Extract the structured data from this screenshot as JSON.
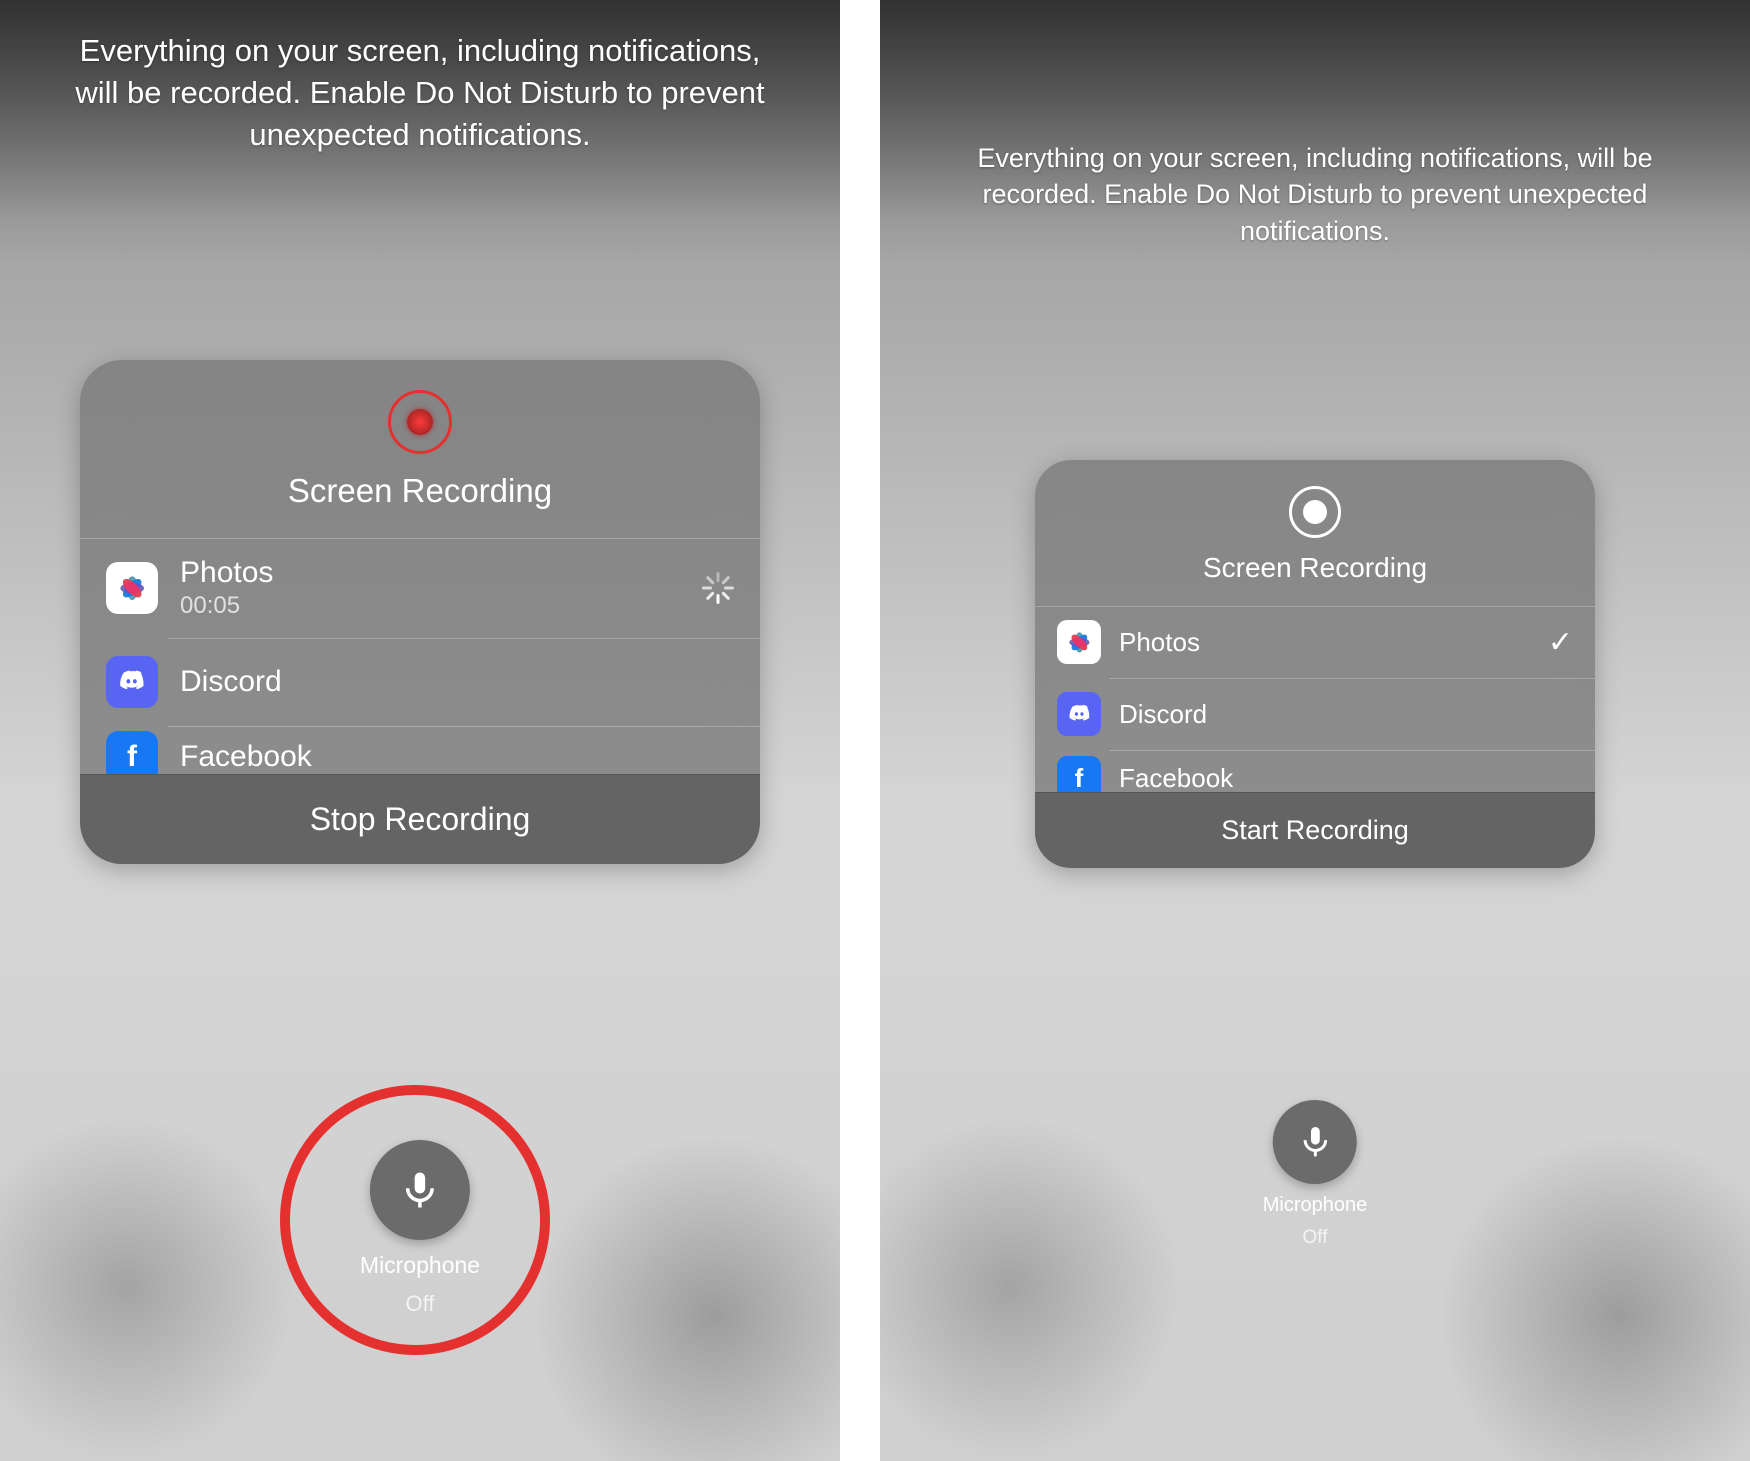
{
  "left": {
    "info": "Everything on your screen, including notifications, will be recorded. Enable Do Not Disturb to prevent unexpected notifications.",
    "title": "Screen Recording",
    "recording": true,
    "destinations": [
      {
        "app": "Photos",
        "elapsed": "00:05",
        "status": "loading"
      },
      {
        "app": "Discord"
      },
      {
        "app": "Facebook",
        "truncated": true
      }
    ],
    "action": "Stop Recording",
    "mic": {
      "label": "Microphone",
      "state": "Off"
    },
    "highlighted": true
  },
  "right": {
    "info": "Everything on your screen, including notifications, will be recorded. Enable Do Not Disturb to prevent unexpected notifications.",
    "title": "Screen Recording",
    "recording": false,
    "destinations": [
      {
        "app": "Photos",
        "selected": true
      },
      {
        "app": "Discord"
      },
      {
        "app": "Facebook",
        "truncated": true
      }
    ],
    "action": "Start Recording",
    "mic": {
      "label": "Microphone",
      "state": "Off"
    }
  }
}
